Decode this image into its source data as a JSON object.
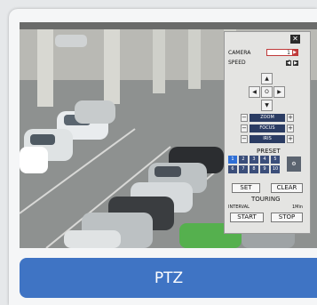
{
  "banner": {
    "label": "PTZ"
  },
  "panel": {
    "close_icon": "✕",
    "camera_label": "CAMERA",
    "camera_value": "1",
    "speed_label": "SPEED",
    "speed_value": "3",
    "dpad": {
      "up": "▲",
      "down": "▼",
      "left": "◀",
      "right": "▶",
      "center": "O"
    },
    "zoom_label": "ZOOM",
    "focus_label": "FOCUS",
    "iris_label": "IRIS",
    "minus": "−",
    "plus": "+",
    "preset_label": "PRESET",
    "presets": [
      "1",
      "2",
      "3",
      "4",
      "5",
      "6",
      "7",
      "8",
      "9",
      "10"
    ],
    "selected_preset": "1",
    "set_label": "SET",
    "clear_label": "CLEAR",
    "touring_label": "TOURING",
    "interval_label": "INTERVAL",
    "interval_unit": "1Min",
    "start_label": "START",
    "stop_label": "STOP"
  },
  "colors": {
    "banner_bg": "#3f74c4",
    "panel_bg": "#e4e4e2",
    "preset_selected": "#2f6fd6"
  }
}
